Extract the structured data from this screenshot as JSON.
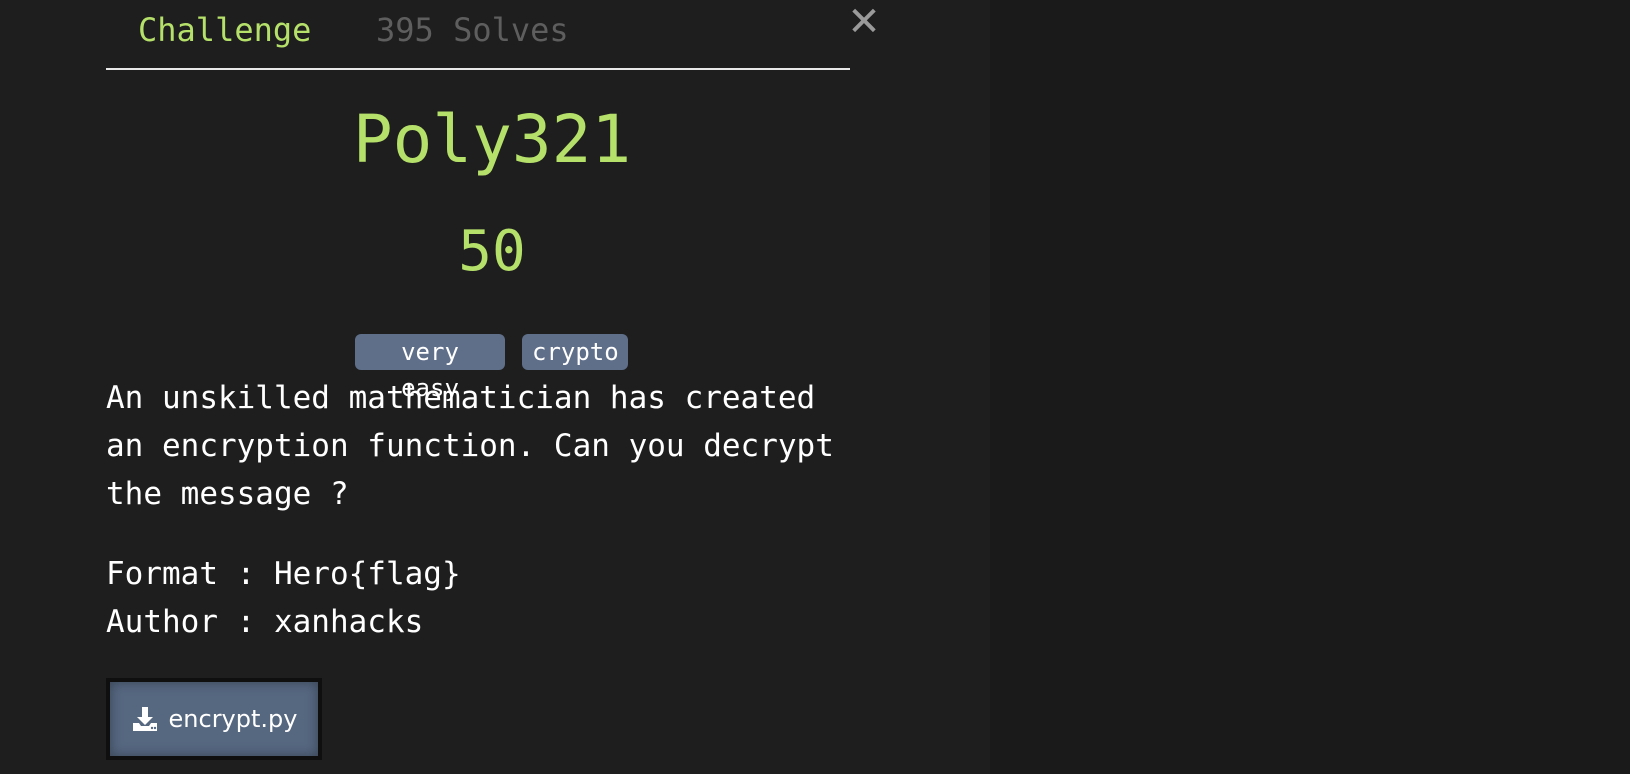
{
  "tabs": {
    "challenge": "Challenge",
    "solves": "395 Solves"
  },
  "close": {
    "symbol": "✕"
  },
  "challenge": {
    "name": "Poly321",
    "points": "50",
    "tags": [
      "very easy",
      "crypto"
    ],
    "description": "An unskilled mathematician has created\nan encryption function. Can you decrypt\nthe message ?",
    "format_line": "Format : Hero{flag}",
    "author_line": "Author : xanhacks"
  },
  "files": [
    {
      "name": "encrypt.py",
      "icon": "download-icon"
    }
  ],
  "colors": {
    "accent": "#b5e06a",
    "tag_bg": "#5f6f8a",
    "file_btn_bg": "#566780",
    "background": "#1e1e1e"
  }
}
